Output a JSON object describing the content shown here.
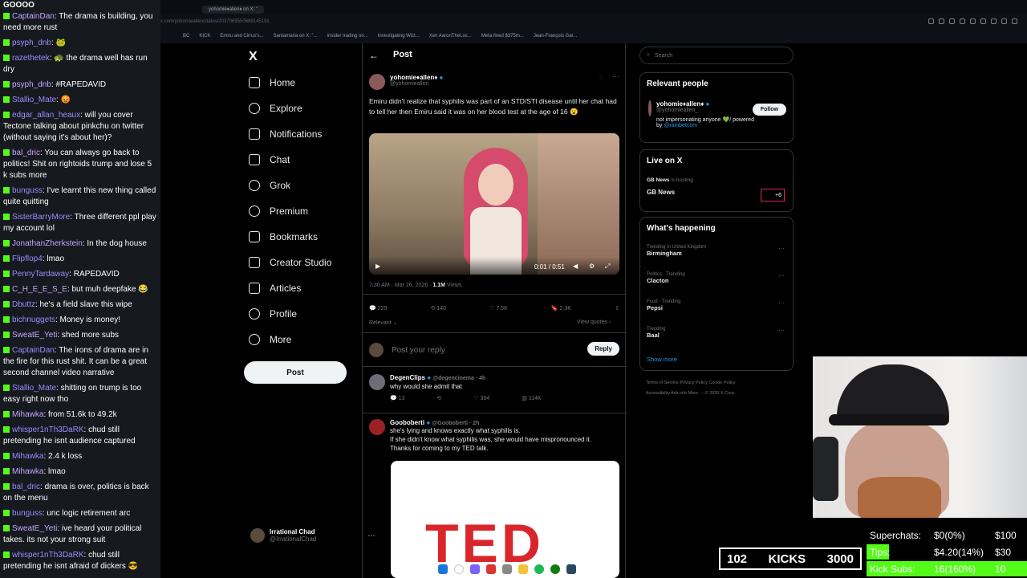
{
  "browser": {
    "tab": "yohomie♦allen♦ on X: \"",
    "url": "x.com/yohomieallen/status/20370695506891451​91",
    "bookmarks": [
      "BC",
      "KICK",
      "Emiru and Cirrus's...",
      "Santamaria on X: \"...",
      "insider trading on...",
      "Investigating Wizt...",
      "Xen AaronTheLoc...",
      "Meta fined $375m...",
      "Jean-François Gar..."
    ]
  },
  "chat": {
    "top": "GOOOO",
    "messages": [
      {
        "user": "CaptainDan",
        "text": "The drama is building, you need more rust"
      },
      {
        "user": "psyph_dnb",
        "text": "🐸"
      },
      {
        "user": "razethetek",
        "text": "🐢 the drama well has run dry"
      },
      {
        "user": "psyph_dnb",
        "text": "#RAPEDAVID"
      },
      {
        "user": "Stallio_Mate",
        "text": "😡"
      },
      {
        "user": "edgar_allan_heaux",
        "text": "will you cover Tectone talking about pinkchu on twitter (without saying it's about her)?"
      },
      {
        "user": "bal_dric",
        "text": "You can always go back to politics! Shit on rightoids trump and lose 5 k subs more"
      },
      {
        "user": "bunguss",
        "text": "I've learnt this new thing called quite quitting"
      },
      {
        "user": "SisterBarryMore",
        "text": "Three different ppl play my account lol"
      },
      {
        "user": "JonathanZherkstein",
        "text": "In the dog house"
      },
      {
        "user": "Flipflop4",
        "text": "lmao"
      },
      {
        "user": "PennyTardaway",
        "text": "RAPEDAVID"
      },
      {
        "user": "C_H_E_E_S_E",
        "text": "but muh deepfake 😂"
      },
      {
        "user": "Dbuttz",
        "text": "he's a field slave this wipe"
      },
      {
        "user": "bichnuggets",
        "text": "Money is money!"
      },
      {
        "user": "SweatE_Yeti",
        "text": "shed more subs"
      },
      {
        "user": "CaptainDan",
        "text": "The irons of drama are in the fire for this rust shit. It can be a great second channel video narrative"
      },
      {
        "user": "Stallio_Mate",
        "text": "shitting on trump is too easy right now tho"
      },
      {
        "user": "Mihawka",
        "text": "from 51.6k to 49.2k"
      },
      {
        "user": "whisper1nTh3DaRK",
        "text": "chud still pretending he isnt audience captured"
      },
      {
        "user": "Mihawka",
        "text": "2.4 k loss"
      },
      {
        "user": "Mihawka",
        "text": "lmao"
      },
      {
        "user": "bal_dric",
        "text": "drama is over, politics is back on the menu"
      },
      {
        "user": "bunguss",
        "text": "unc logic retirement arc"
      },
      {
        "user": "SweatE_Yeti",
        "text": "ive heard your political takes. its not your strong suit"
      },
      {
        "user": "whisper1nTh3DaRK",
        "text": "chud still pretending he isnt afraid of dickers 😎"
      }
    ]
  },
  "nav": {
    "logo": "X",
    "items": [
      "Home",
      "Explore",
      "Notifications",
      "Chat",
      "Grok",
      "Premium",
      "Bookmarks",
      "Creator Studio",
      "Articles",
      "Profile",
      "More"
    ],
    "post": "Post",
    "profile_name": "Irrational Chad",
    "profile_handle": "@IrrationalChad"
  },
  "post": {
    "header": "Post",
    "name": "yohomie♦allen♦",
    "handle": "@yohomieallen",
    "text": "Emiru didn't realize that syphilis was part of an STD/STI disease until her chat had to tell her then Emiru said it was on her blood test at the age of 16 😮",
    "video_time": "0:01 / 0:51",
    "timestamp": "7:30 AM · Mar 26, 2026 · ",
    "views": "1.1M",
    "views_label": " Views",
    "replies": "229",
    "reposts": "140",
    "likes": "7.5K",
    "bookmarks": "2.3K",
    "relevant": "Relevant ⌄",
    "view_quotes": "View quotes ›",
    "reply_placeholder": "Post your reply",
    "reply_button": "Reply"
  },
  "replies": [
    {
      "name": "DegenClips",
      "handle": "@degencinema · 4h",
      "text": "why would she admit that",
      "r": "13",
      "l": "394",
      "v": "114K"
    },
    {
      "name": "Gooboberti",
      "handle": "@Gooboberti · 2h",
      "text": "she's lying and knows exactly what syphilis is.\nIf she didn't know what syphilis was, she would have mispronounced it.\nThanks for coming to my TED talk.",
      "image": "TED"
    }
  ],
  "right": {
    "search": "Search",
    "relevant_title": "Relevant people",
    "person_name": "yohomie♦allen♦",
    "person_handle": "@yohomieallen_",
    "person_bio": "not impersonating anyone 💚/ powered by ",
    "person_link": "@rainbetcom",
    "follow": "Follow",
    "live_title": "Live on X",
    "live_host": "GB News",
    "live_hosting": " is hosting",
    "live_name": "GB News",
    "live_badge": "+6",
    "happening_title": "What's happening",
    "trends": [
      {
        "context": "Trending in United Kingdom",
        "name": "Birmingham"
      },
      {
        "context": "Politics · Trending",
        "name": "Clacton"
      },
      {
        "context": "Food · Trending",
        "name": "Pepsi"
      },
      {
        "context": "Trending",
        "name": "Baal"
      }
    ],
    "show_more": "Show more",
    "footer1": "Terms of Service   Privacy Policy   Cookie Policy",
    "footer2": "Accessibility   Ads info   More ···   © 2026 X Corp."
  },
  "overlay": {
    "kicks_count": "102",
    "kicks_label": "KICKS",
    "kicks_goal": "3000",
    "goals": [
      {
        "label": "Superchats:",
        "value": "$0(0%)",
        "target": "$100",
        "fill": 0
      },
      {
        "label": "Tips:",
        "value": "$4.20(14%)",
        "target": "$30",
        "fill": 0.14
      },
      {
        "label": "Kick Subs:",
        "value": "16(160%)",
        "target": "10",
        "fill": 1
      }
    ]
  },
  "colors": {
    "kick_green": "#53fc18",
    "x_blue": "#1d9bf0"
  }
}
